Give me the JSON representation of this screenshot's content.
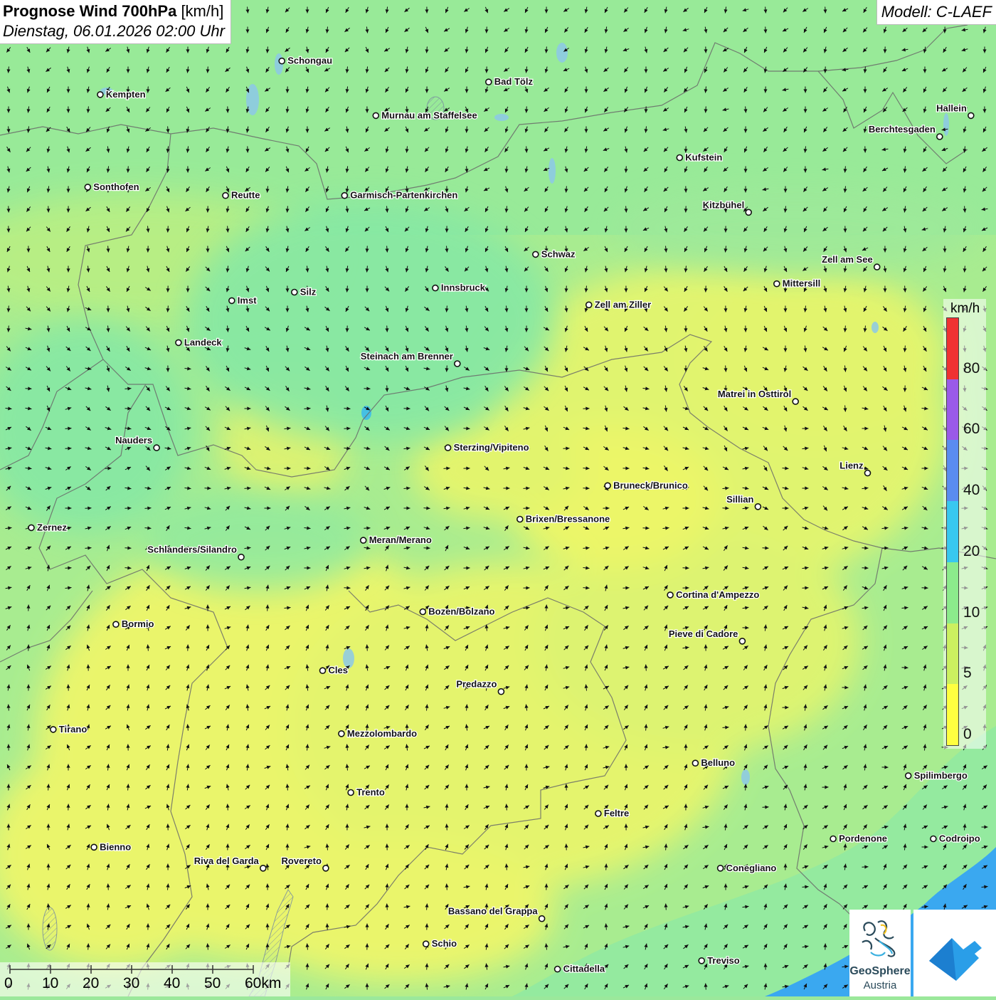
{
  "header": {
    "title_bold": "Prognose Wind 700hPa",
    "title_unit": "[km/h]",
    "datetime": "Dienstag, 06.01.2026 02:00 Uhr"
  },
  "model_label": "Modell: C-LAEF",
  "legend": {
    "unit": "km/h",
    "ticks": [
      "0",
      "5",
      "10",
      "20",
      "40",
      "60",
      "80"
    ],
    "colors": [
      "#ffff40",
      "#ccf060",
      "#8ceb8c",
      "#38c8f0",
      "#5a8cf0",
      "#9a5ae8",
      "#f03232"
    ]
  },
  "scale_bar": {
    "labels": [
      "0",
      "10",
      "20",
      "30",
      "40",
      "50",
      "60km"
    ]
  },
  "logos": {
    "geosphere_line1": "GeoSphere",
    "geosphere_line2": "Austria"
  },
  "cities": [
    {
      "name": "Schongau",
      "lon": 10.9,
      "lat": 47.81
    },
    {
      "name": "Bad Tölz",
      "lon": 11.56,
      "lat": 47.76
    },
    {
      "name": "Kempten",
      "lon": 10.32,
      "lat": 47.73
    },
    {
      "name": "Murnau am Staffelsee",
      "lon": 11.2,
      "lat": 47.68
    },
    {
      "name": "Hallein",
      "lon": 13.1,
      "lat": 47.68
    },
    {
      "name": "Berchtesgaden",
      "lon": 13.0,
      "lat": 47.63
    },
    {
      "name": "Kufstein",
      "lon": 12.17,
      "lat": 47.58
    },
    {
      "name": "Sonthofen",
      "lon": 10.28,
      "lat": 47.51
    },
    {
      "name": "Reutte",
      "lon": 10.72,
      "lat": 47.49
    },
    {
      "name": "Garmisch-Partenkirchen",
      "lon": 11.1,
      "lat": 47.49
    },
    {
      "name": "Kitzbühel",
      "lon": 12.39,
      "lat": 47.45
    },
    {
      "name": "Schwaz",
      "lon": 11.71,
      "lat": 47.35
    },
    {
      "name": "Zell am See",
      "lon": 12.8,
      "lat": 47.32
    },
    {
      "name": "Silz",
      "lon": 10.94,
      "lat": 47.26
    },
    {
      "name": "Innsbruck",
      "lon": 11.39,
      "lat": 47.27
    },
    {
      "name": "Mittersill",
      "lon": 12.48,
      "lat": 47.28
    },
    {
      "name": "Imst",
      "lon": 10.74,
      "lat": 47.24
    },
    {
      "name": "Zell am Ziller",
      "lon": 11.88,
      "lat": 47.23
    },
    {
      "name": "Landeck",
      "lon": 10.57,
      "lat": 47.14
    },
    {
      "name": "Steinach am Brenner",
      "lon": 11.46,
      "lat": 47.09
    },
    {
      "name": "Matrei in Osttirol",
      "lon": 12.54,
      "lat": 47.0
    },
    {
      "name": "Nauders",
      "lon": 10.5,
      "lat": 46.89
    },
    {
      "name": "Sterzing/Vipiteno",
      "lon": 11.43,
      "lat": 46.89
    },
    {
      "name": "Lienz",
      "lon": 12.77,
      "lat": 46.83
    },
    {
      "name": "Bruneck/Brunico",
      "lon": 11.94,
      "lat": 46.8
    },
    {
      "name": "Sillian",
      "lon": 12.42,
      "lat": 46.75
    },
    {
      "name": "Brixen/Bressanone",
      "lon": 11.66,
      "lat": 46.72
    },
    {
      "name": "Zernez",
      "lon": 10.1,
      "lat": 46.7
    },
    {
      "name": "Meran/Merano",
      "lon": 11.16,
      "lat": 46.67
    },
    {
      "name": "Schlanders/Silandro",
      "lon": 10.77,
      "lat": 46.63
    },
    {
      "name": "Cortina d'Ampezzo",
      "lon": 12.14,
      "lat": 46.54
    },
    {
      "name": "Bozen/Bolzano",
      "lon": 11.35,
      "lat": 46.5
    },
    {
      "name": "Bormio",
      "lon": 10.37,
      "lat": 46.47
    },
    {
      "name": "Pieve di Cadore",
      "lon": 12.37,
      "lat": 46.43
    },
    {
      "name": "Cles",
      "lon": 11.03,
      "lat": 46.36
    },
    {
      "name": "Predazzo",
      "lon": 11.6,
      "lat": 46.31
    },
    {
      "name": "Tirano",
      "lon": 10.17,
      "lat": 46.22
    },
    {
      "name": "Mezzolombardo",
      "lon": 11.09,
      "lat": 46.21
    },
    {
      "name": "Belluno",
      "lon": 12.22,
      "lat": 46.14
    },
    {
      "name": "Spilimbergo",
      "lon": 12.9,
      "lat": 46.11
    },
    {
      "name": "Trento",
      "lon": 11.12,
      "lat": 46.07
    },
    {
      "name": "Feltre",
      "lon": 11.91,
      "lat": 46.02
    },
    {
      "name": "Bienno",
      "lon": 10.3,
      "lat": 45.94
    },
    {
      "name": "Pordenone",
      "lon": 12.66,
      "lat": 45.96
    },
    {
      "name": "Codroipo",
      "lon": 12.98,
      "lat": 45.96
    },
    {
      "name": "Riva del Garda",
      "lon": 10.84,
      "lat": 45.89
    },
    {
      "name": "Rovereto",
      "lon": 11.04,
      "lat": 45.89
    },
    {
      "name": "Conegliano",
      "lon": 12.3,
      "lat": 45.89
    },
    {
      "name": "Bassano del Grappa",
      "lon": 11.73,
      "lat": 45.77
    },
    {
      "name": "Schio",
      "lon": 11.36,
      "lat": 45.71
    },
    {
      "name": "Treviso",
      "lon": 12.24,
      "lat": 45.67
    },
    {
      "name": "Cittadella",
      "lon": 11.78,
      "lat": 45.65
    }
  ]
}
